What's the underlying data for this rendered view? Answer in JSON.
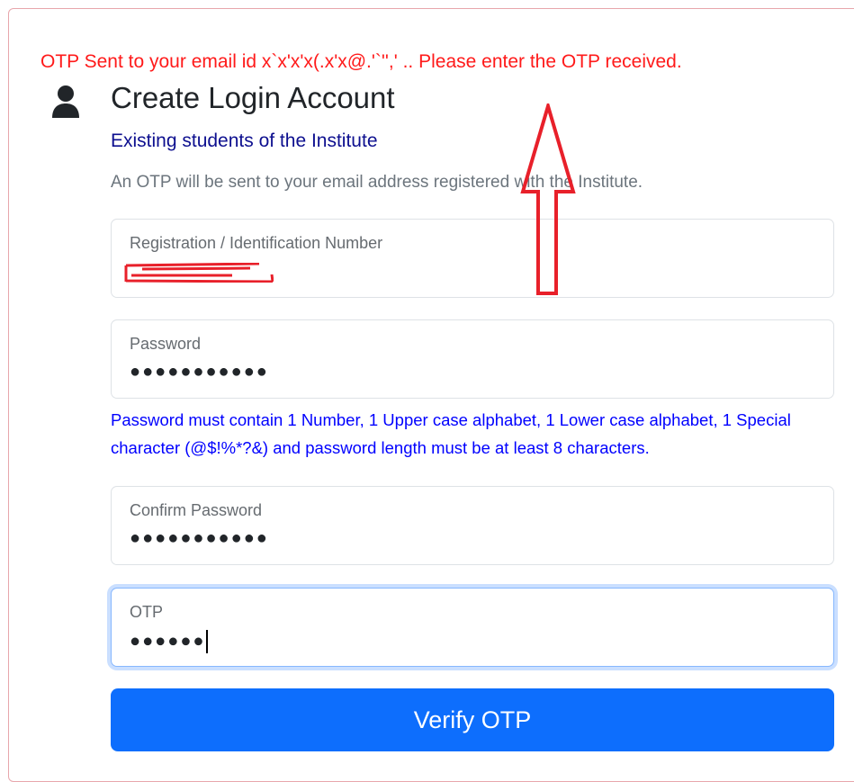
{
  "alert": {
    "message": "OTP Sent to your email id x`x'x'x(.x'x@.'`'',' .. Please enter the OTP received.",
    "color": "#ff1a1a"
  },
  "header": {
    "icon": "user-icon",
    "title": "Create Login Account",
    "subtitle": "Existing students of the Institute",
    "note": "An OTP will be sent to your email address registered with the Institute."
  },
  "form": {
    "registration": {
      "label": "Registration / Identification Number",
      "value_redacted": true
    },
    "password": {
      "label": "Password",
      "value": "●●●●●●●●●●●"
    },
    "password_help": "Password must contain 1 Number, 1 Upper case alphabet, 1 Lower case alphabet, 1 Special character (@$!%*?&) and password length must be at least 8 characters.",
    "confirm_password": {
      "label": "Confirm Password",
      "value": "●●●●●●●●●●●"
    },
    "otp": {
      "label": "OTP",
      "value": "●●●●●●",
      "focused": true
    },
    "submit_label": "Verify OTP"
  },
  "colors": {
    "primary": "#0d6efd",
    "help_text": "#0000ff",
    "subtitle": "#0d0f8f",
    "annotation": "#e8202a"
  }
}
